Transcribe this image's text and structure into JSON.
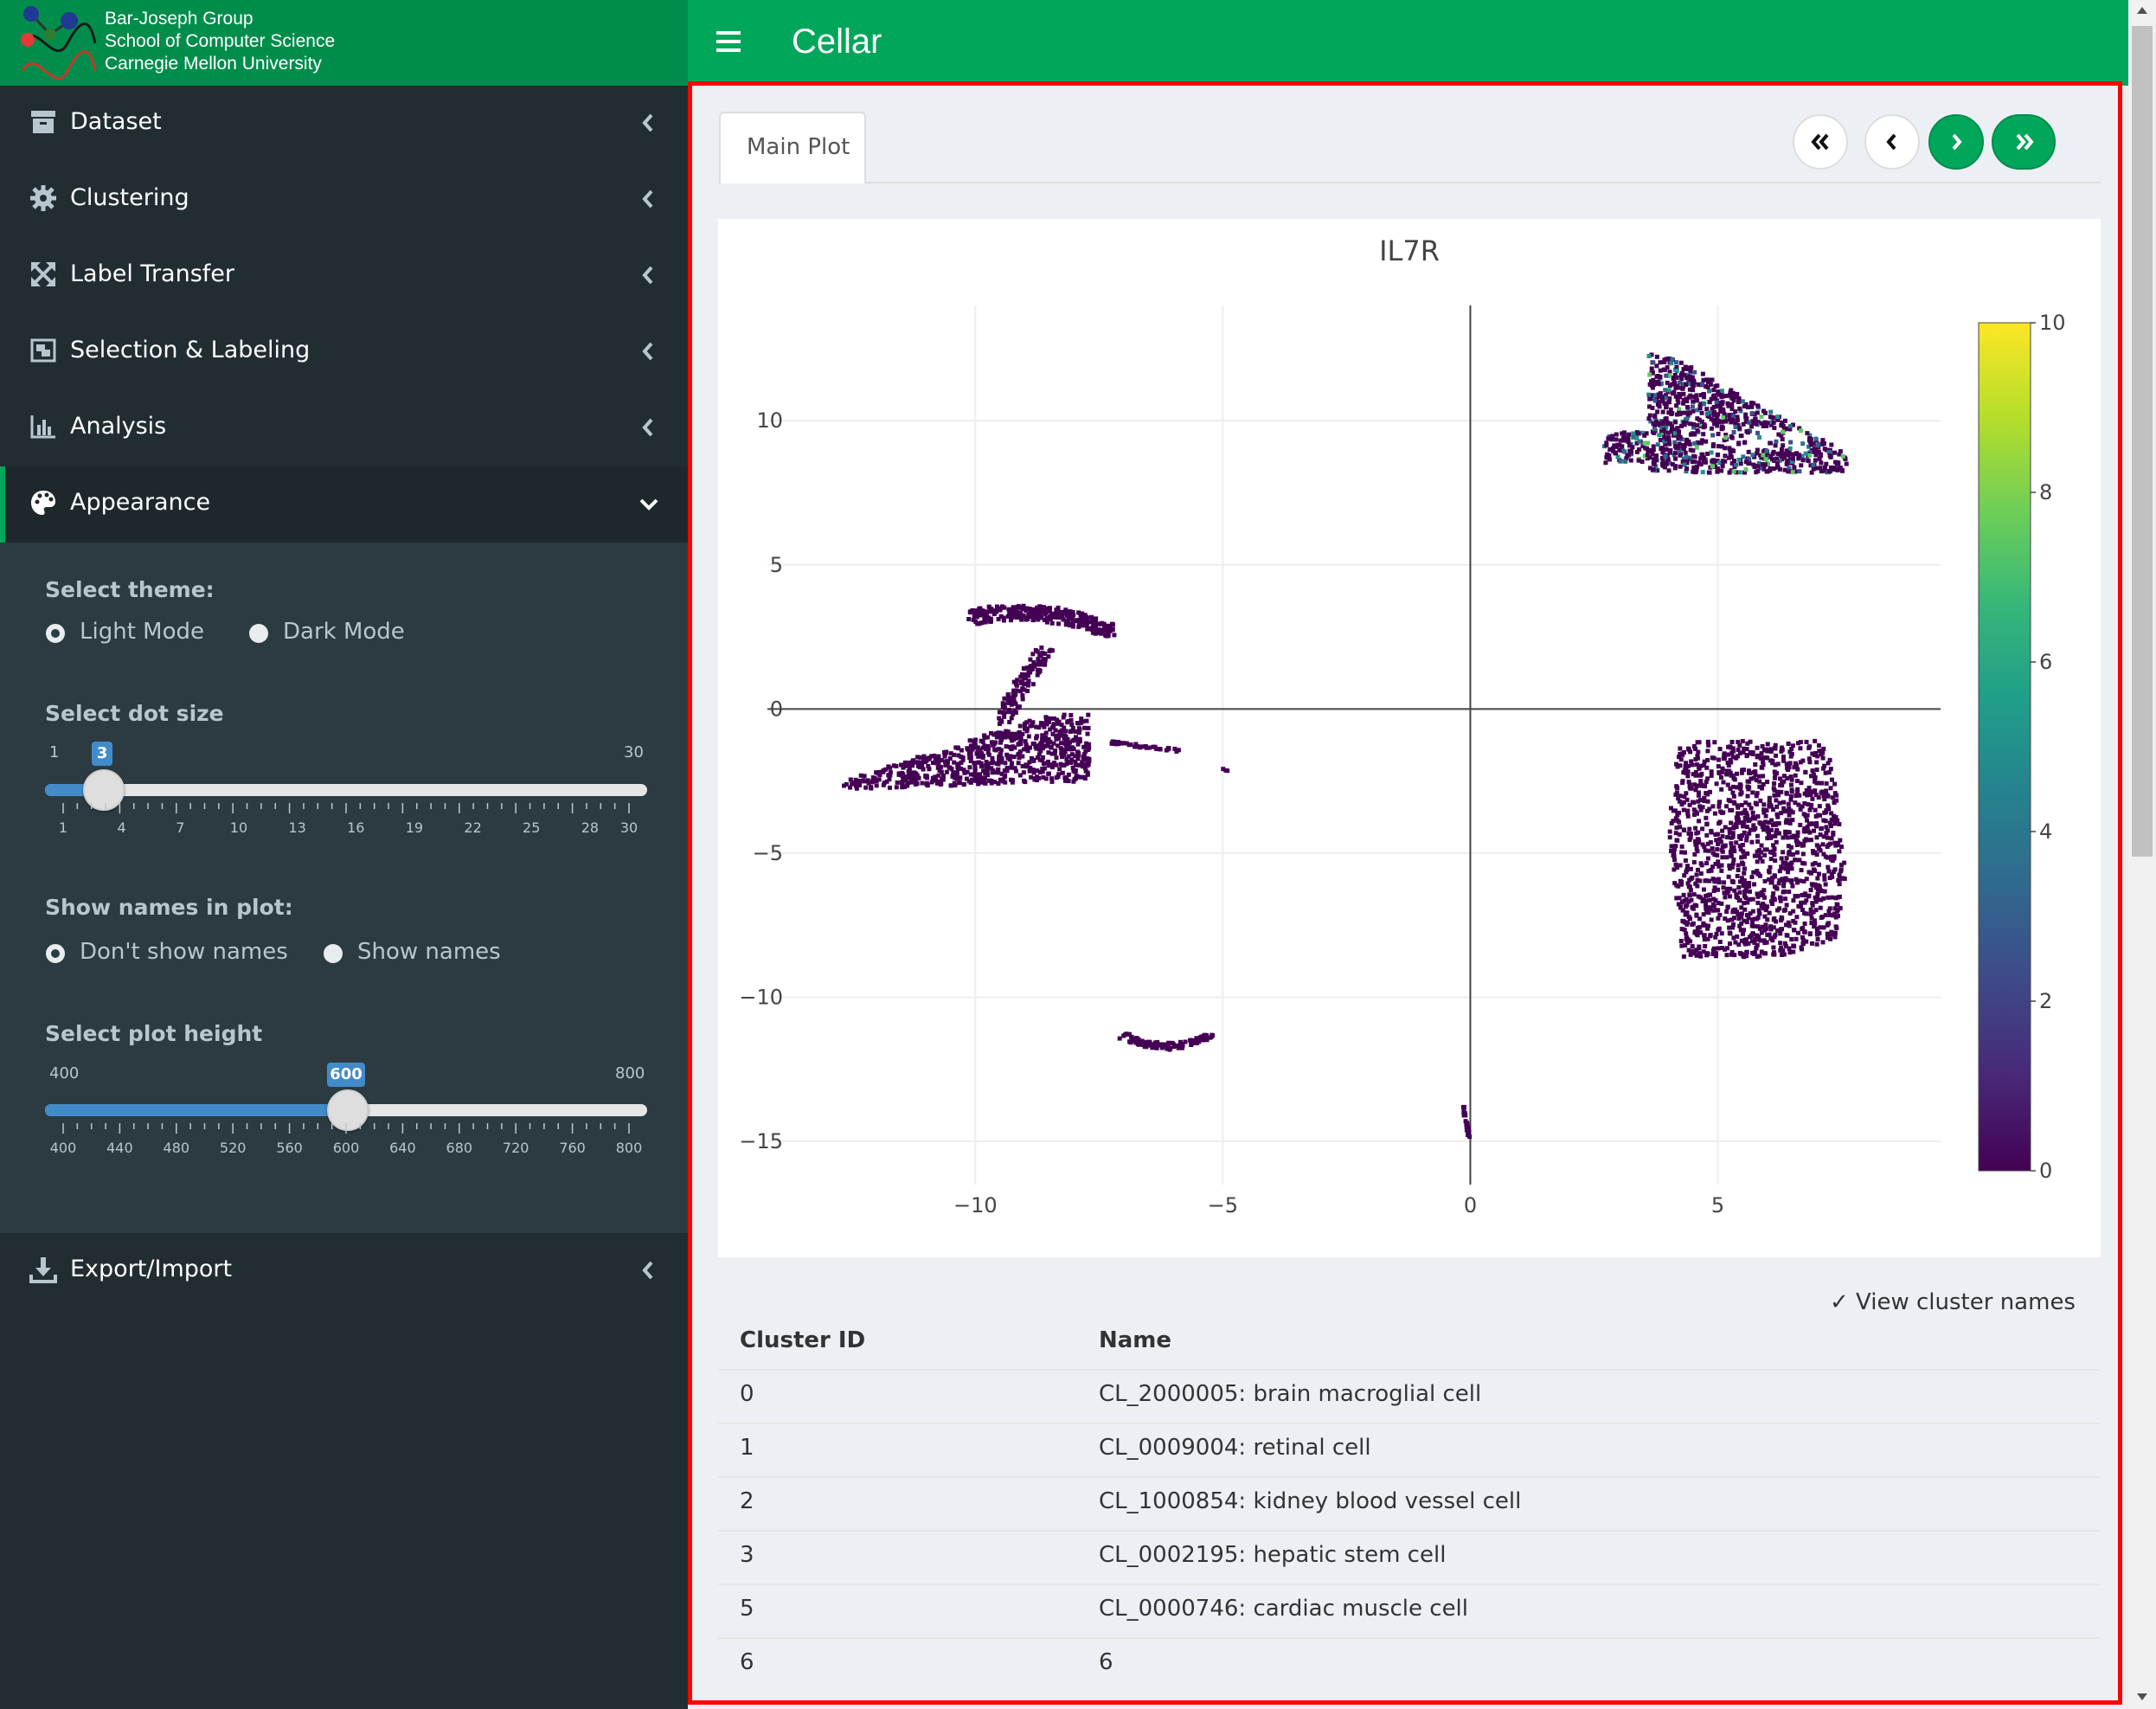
{
  "logo": {
    "line1": "Bar-Joseph Group",
    "line2": "School of Computer Science",
    "line3": "Carnegie Mellon University"
  },
  "header": {
    "title": "Cellar",
    "menu_icon": "hamburger-icon"
  },
  "sidebar": {
    "items": [
      {
        "label": "Dataset",
        "icon": "archive-icon"
      },
      {
        "label": "Clustering",
        "icon": "gear-icon"
      },
      {
        "label": "Label Transfer",
        "icon": "expand-arrows-icon"
      },
      {
        "label": "Selection & Labeling",
        "icon": "object-group-icon"
      },
      {
        "label": "Analysis",
        "icon": "bar-chart-icon"
      },
      {
        "label": "Appearance",
        "icon": "palette-icon"
      },
      {
        "label": "Export/Import",
        "icon": "download-icon"
      }
    ],
    "appearance": {
      "theme_label": "Select theme:",
      "theme_options": [
        "Light Mode",
        "Dark Mode"
      ],
      "theme_selected": "Light Mode",
      "dot_size_label": "Select dot size",
      "dot_size": {
        "min": 1,
        "max": 30,
        "value": 3,
        "ticks": [
          "1",
          "4",
          "7",
          "10",
          "13",
          "16",
          "19",
          "22",
          "25",
          "28",
          "30"
        ]
      },
      "names_label": "Show names in plot:",
      "names_options": [
        "Don't show names",
        "Show names"
      ],
      "names_selected": "Don't show names",
      "height_label": "Select plot height",
      "plot_height": {
        "min": 400,
        "max": 800,
        "value": 600,
        "ticks": [
          "400",
          "440",
          "480",
          "520",
          "560",
          "600",
          "640",
          "680",
          "720",
          "760",
          "800"
        ]
      }
    }
  },
  "tabs": [
    {
      "label": "Main Plot",
      "active": true
    }
  ],
  "nav_buttons": [
    {
      "icon": "double-chevron-left-icon"
    },
    {
      "icon": "chevron-left-icon"
    },
    {
      "icon": "chevron-right-icon"
    },
    {
      "icon": "double-chevron-right-icon"
    }
  ],
  "chart_data": {
    "type": "scatter",
    "title": "IL7R",
    "xlabel": "",
    "ylabel": "",
    "xlim": [
      -14.2,
      9.5
    ],
    "ylim": [
      -16.5,
      14.0
    ],
    "x_ticks": [
      "−10",
      "−5",
      "0",
      "5"
    ],
    "y_ticks": [
      "10",
      "5",
      "0",
      "−5",
      "−10",
      "−15"
    ],
    "grid": true,
    "colorbar": {
      "min": 0,
      "max": 10,
      "ticks": [
        "0",
        "2",
        "4",
        "6",
        "8",
        "10"
      ],
      "colorscale": "viridis"
    },
    "clusters": [
      {
        "region": "upper-right",
        "cx": 5.3,
        "cy": 9.6,
        "n": 950,
        "high_fraction": 0.2
      },
      {
        "region": "lower-right",
        "cx": 6.0,
        "cy": -4.6,
        "n": 1400,
        "high_fraction": 0.0
      },
      {
        "region": "left-cap",
        "cx": -8.8,
        "cy": 3.1,
        "n": 280,
        "high_fraction": 0.0
      },
      {
        "region": "left-stem",
        "cx": -9.0,
        "cy": 0.8,
        "n": 120,
        "high_fraction": 0.0
      },
      {
        "region": "left-body",
        "cx": -10.0,
        "cy": -1.7,
        "n": 700,
        "high_fraction": 0.0
      },
      {
        "region": "left-tail",
        "cx": -6.9,
        "cy": -1.3,
        "n": 40,
        "high_fraction": 0.0
      },
      {
        "region": "bottom-small",
        "cx": -6.2,
        "cy": -11.5,
        "n": 110,
        "high_fraction": 0.0
      },
      {
        "region": "bottom-center",
        "cx": -0.1,
        "cy": -14.5,
        "n": 30,
        "high_fraction": 0.0
      },
      {
        "region": "isolated",
        "cx": -5.0,
        "cy": -2.1,
        "n": 3,
        "high_fraction": 0.0
      }
    ]
  },
  "table": {
    "view_names_label": "✓ View cluster names",
    "columns": [
      "Cluster ID",
      "Name"
    ],
    "rows": [
      {
        "id": "0",
        "name": "CL_2000005: brain macroglial cell"
      },
      {
        "id": "1",
        "name": "CL_0009004: retinal cell"
      },
      {
        "id": "2",
        "name": "CL_1000854: kidney blood vessel cell"
      },
      {
        "id": "3",
        "name": "CL_0002195: hepatic stem cell"
      },
      {
        "id": "5",
        "name": "CL_0000746: cardiac muscle cell"
      },
      {
        "id": "6",
        "name": "6"
      }
    ]
  },
  "colors": {
    "header": "#00a65a",
    "logo_bg": "#008d4c",
    "sidebar": "#222d32",
    "sidebar_panel": "#2c3b41",
    "slider": "#428bca",
    "frame": "#ff0000",
    "dot_low": "#440154"
  }
}
